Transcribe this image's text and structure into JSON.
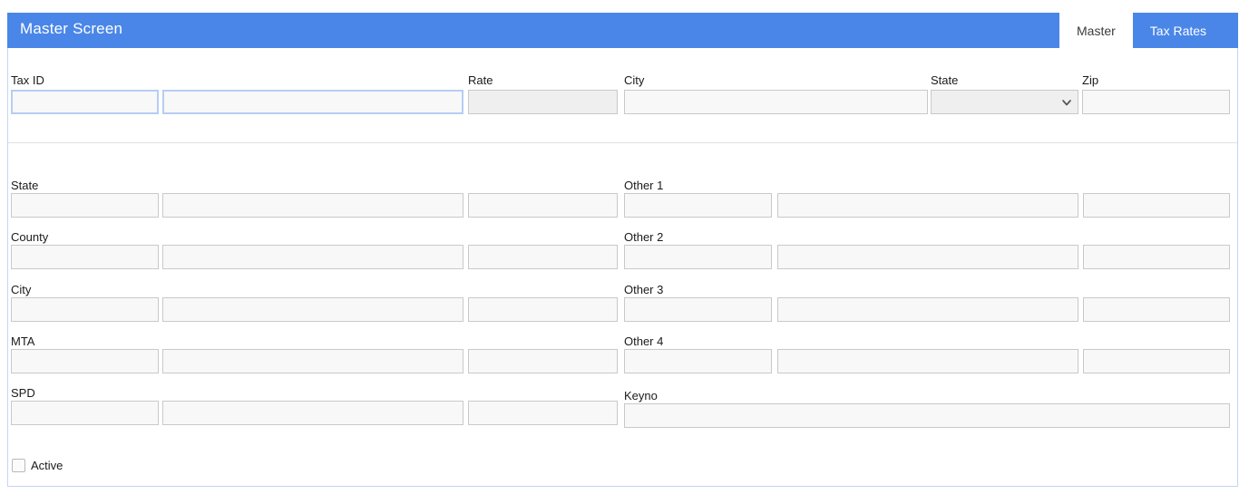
{
  "header": {
    "title": "Master Screen",
    "bar_color": "#4a86e8",
    "title_color": "#ffffff"
  },
  "tabs": [
    {
      "label": "Master",
      "active": true
    },
    {
      "label": "Tax Rates",
      "active": false
    }
  ],
  "top_section": {
    "tax_id": {
      "label": "Tax ID",
      "code_value": "",
      "code_placeholder": "",
      "name_value": "",
      "name_placeholder": ""
    },
    "rate": {
      "label": "Rate",
      "value": "",
      "placeholder": "",
      "disabled": true
    },
    "city": {
      "label": "City",
      "value": "",
      "placeholder": "",
      "disabled": true
    },
    "state": {
      "label": "State",
      "selected": "",
      "options": [
        ""
      ],
      "disabled": true,
      "icon": "chevron-down-icon"
    },
    "zip": {
      "label": "Zip",
      "value": "",
      "placeholder": "",
      "disabled": true
    }
  },
  "left_rows": [
    {
      "label": "State",
      "c1": "",
      "c2": "",
      "c3": ""
    },
    {
      "label": "County",
      "c1": "",
      "c2": "",
      "c3": ""
    },
    {
      "label": "City",
      "c1": "",
      "c2": "",
      "c3": ""
    },
    {
      "label": "MTA",
      "c1": "",
      "c2": "",
      "c3": ""
    },
    {
      "label": "SPD",
      "c1": "",
      "c2": "",
      "c3": ""
    }
  ],
  "right_rows": [
    {
      "label": "Other 1",
      "c1": "",
      "c2": "",
      "c3": ""
    },
    {
      "label": "Other 2",
      "c1": "",
      "c2": "",
      "c3": ""
    },
    {
      "label": "Other 3",
      "c1": "",
      "c2": "",
      "c3": ""
    },
    {
      "label": "Other 4",
      "c1": "",
      "c2": "",
      "c3": ""
    }
  ],
  "keyno": {
    "label": "Keyno",
    "value": "",
    "placeholder": ""
  },
  "active_checkbox": {
    "label": "Active",
    "checked": false
  }
}
